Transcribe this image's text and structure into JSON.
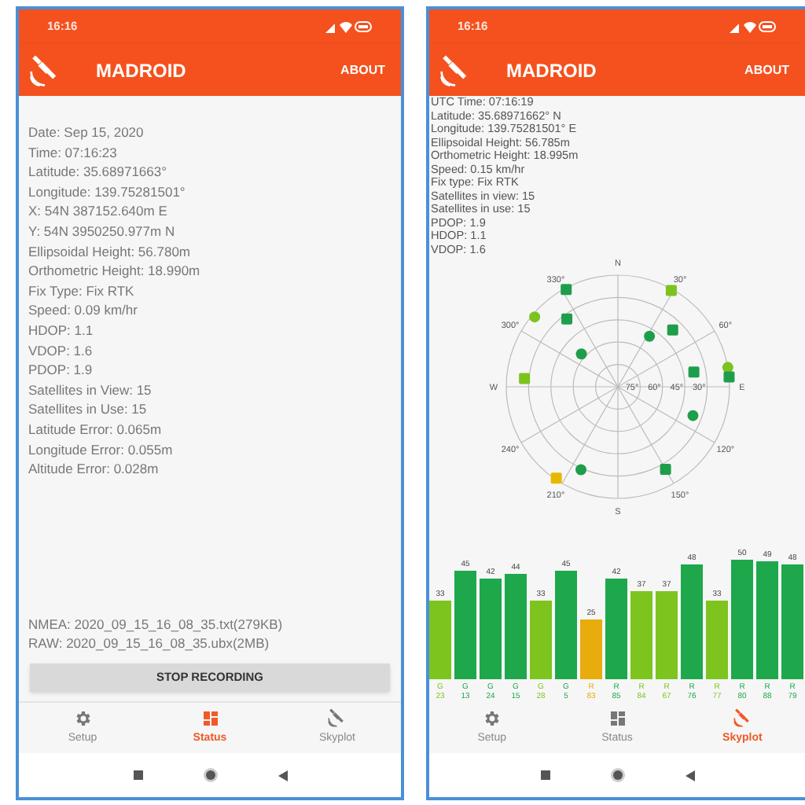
{
  "screens": [
    {
      "kind": "status",
      "status_bar": {
        "time": "16:16"
      },
      "app_bar": {
        "title": "MADROID",
        "action": "ABOUT"
      },
      "lines": [
        "Date: Sep 15, 2020",
        "Time: 07:16:23",
        "Latitude: 35.68971663°",
        "Longitude: 139.75281501°",
        "X: 54N 387152.640m E",
        "Y: 54N 3950250.977m N",
        "Ellipsoidal Height: 56.780m",
        "Orthometric Height: 18.990m",
        "Fix Type: Fix RTK",
        "Speed: 0.09 km/hr",
        "HDOP: 1.1",
        "VDOP: 1.6",
        "PDOP: 1.9",
        "Satellites in View: 15",
        "Satellites in Use: 15",
        "Latitude Error: 0.065m",
        "Longitude Error: 0.055m",
        "Altitude Error: 0.028m"
      ],
      "files": [
        "NMEA: 2020_09_15_16_08_35.txt(279KB)",
        "RAW: 2020_09_15_16_08_35.ubx(2MB)"
      ],
      "button": "STOP RECORDING",
      "nav": [
        {
          "kind": "setup",
          "label": "Setup",
          "selected": false
        },
        {
          "kind": "status",
          "label": "Status",
          "selected": true
        },
        {
          "kind": "skyplot",
          "label": "Skyplot",
          "selected": false
        }
      ]
    },
    {
      "kind": "skyplot",
      "status_bar": {
        "time": "16:16"
      },
      "app_bar": {
        "title": "MADROID",
        "action": "ABOUT"
      },
      "lines": [
        "UTC Time: 07:16:19",
        "Latitude: 35.68971662° N",
        "Longitude: 139.75281501° E",
        "Ellipsoidal Height: 56.785m",
        "Orthometric Height: 18.995m",
        "Speed: 0.15 km/hr",
        "Fix type: Fix RTK",
        "Satellites in view: 15",
        "Satellites in use: 15",
        "PDOP: 1.9",
        "HDOP: 1.1",
        "VDOP: 1.6"
      ],
      "skyplot": {
        "azimuth_labels": [
          "N",
          "30°",
          "60°",
          "E",
          "120°",
          "150°",
          "S",
          "210°",
          "240°",
          "W",
          "300°",
          "330°"
        ],
        "elevation_labels": [
          "75°",
          "60°",
          "45°",
          "30°"
        ],
        "satellites": [
          {
            "kind": "square",
            "color": "#1e9e4a"
          },
          {
            "kind": "square",
            "color": "#7cc31e"
          },
          {
            "kind": "circle",
            "color": "#7cc31e"
          },
          {
            "kind": "square",
            "color": "#1e9e4a"
          },
          {
            "kind": "circle",
            "color": "#1e9e4a"
          },
          {
            "kind": "square",
            "color": "#1e9e4a"
          },
          {
            "kind": "circle",
            "color": "#1e9e4a"
          },
          {
            "kind": "square",
            "color": "#1e9e4a"
          },
          {
            "kind": "circle",
            "color": "#7cc31e"
          },
          {
            "kind": "square",
            "color": "#1e9e4a"
          },
          {
            "kind": "square",
            "color": "#7cc31e"
          },
          {
            "kind": "circle",
            "color": "#1e9e4a"
          },
          {
            "kind": "circle",
            "color": "#1e9e4a"
          },
          {
            "kind": "square",
            "color": "#1e9e4a"
          },
          {
            "kind": "square",
            "color": "#e6b800"
          }
        ]
      },
      "signal_bars": [
        {
          "value": "33",
          "system": "G",
          "id": "23",
          "color": "#7dc41f"
        },
        {
          "value": "45",
          "system": "G",
          "id": "13",
          "color": "#1ea84b"
        },
        {
          "value": "42",
          "system": "G",
          "id": "24",
          "color": "#1ea84b"
        },
        {
          "value": "44",
          "system": "G",
          "id": "15",
          "color": "#1ea84b"
        },
        {
          "value": "33",
          "system": "G",
          "id": "28",
          "color": "#7dc41f"
        },
        {
          "value": "45",
          "system": "G",
          "id": "5",
          "color": "#1ea84b"
        },
        {
          "value": "25",
          "system": "R",
          "id": "83",
          "color": "#e8ac0c"
        },
        {
          "value": "42",
          "system": "R",
          "id": "85",
          "color": "#1ea84b"
        },
        {
          "value": "37",
          "system": "R",
          "id": "84",
          "color": "#7dc41f"
        },
        {
          "value": "37",
          "system": "R",
          "id": "67",
          "color": "#7dc41f"
        },
        {
          "value": "48",
          "system": "R",
          "id": "76",
          "color": "#1ea84b"
        },
        {
          "value": "33",
          "system": "R",
          "id": "77",
          "color": "#7dc41f"
        },
        {
          "value": "50",
          "system": "R",
          "id": "80",
          "color": "#1ea84b"
        },
        {
          "value": "49",
          "system": "R",
          "id": "88",
          "color": "#1ea84b"
        },
        {
          "value": "48",
          "system": "R",
          "id": "79",
          "color": "#1ea84b"
        }
      ],
      "nav": [
        {
          "kind": "setup",
          "label": "Setup",
          "selected": false
        },
        {
          "kind": "status",
          "label": "Status",
          "selected": false
        },
        {
          "kind": "skyplot",
          "label": "Skyplot",
          "selected": true
        }
      ]
    }
  ]
}
